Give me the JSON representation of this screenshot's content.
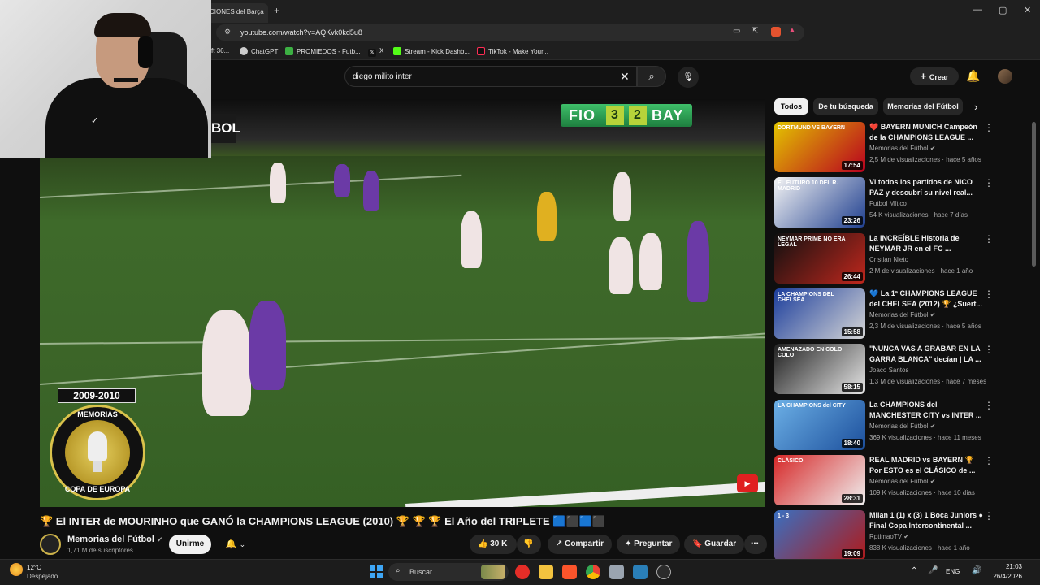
{
  "browser": {
    "tab_title": "CIONES del Barça",
    "new_tab": "+",
    "url": "youtube.com/watch?v=AQKvk0kd5u8",
    "bookmarks": [
      {
        "label": "ft 36...",
        "color": "#888888"
      },
      {
        "label": "ChatGPT",
        "color": "#cccccc"
      },
      {
        "label": "PROMIEDOS - Futb...",
        "color": "#3cb043"
      },
      {
        "label": "X",
        "color": "#ffffff"
      },
      {
        "label": "Stream - Kick Dashb...",
        "color": "#53fc18"
      },
      {
        "label": "TikTok - Make Your...",
        "color": "#ff2d55"
      }
    ],
    "window_controls": [
      "—",
      "▢",
      "✕"
    ]
  },
  "header": {
    "search_value": "diego milito inter",
    "create_label": "Crear"
  },
  "overlay": {
    "stream_label": "BOL"
  },
  "video": {
    "scoreboard": {
      "home": "FIO",
      "home_score": "3",
      "away_score": "2",
      "away": "BAY"
    },
    "season_label": "2009-2010",
    "badge_top": "MEMORIAS",
    "badge_bottom": "COPA DE EUROPA",
    "subscribe_icon": "▶"
  },
  "info": {
    "title": "🏆 El INTER de MOURINHO que GANÓ la CHAMPIONS LEAGUE (2010) 🏆 🏆 🏆 El Año del TRIPLETE 🟦⬛🟦⬛",
    "channel_name": "Memorias del Fútbol",
    "subscribers": "1,71 M de suscriptores",
    "join_label": "Unirme",
    "likes": "30 K",
    "share_label": "Compartir",
    "ask_label": "Preguntar",
    "save_label": "Guardar"
  },
  "sidebar": {
    "chips": [
      "Todos",
      "De tu búsqueda",
      "Memorias del Fútbol"
    ],
    "recommendations": [
      {
        "title": "❤️ BAYERN MUNICH Campeón de la CHAMPIONS LEAGUE ...",
        "channel": "Memorias del Fútbol",
        "verified": true,
        "views": "2,5 M de visualizaciones",
        "age": "hace 5 años",
        "duration": "17:54",
        "thumb_text": "DORTMUND VS BAYERN",
        "c1": "#e3c500",
        "c2": "#b8001f"
      },
      {
        "title": "Vi todos los partidos de NICO PAZ y descubrí su nivel real...",
        "channel": "Futbol Mítico",
        "verified": false,
        "views": "54 K visualizaciones",
        "age": "hace 7 días",
        "duration": "23:26",
        "thumb_text": "EL FUTURO 10 DEL R. MADRID",
        "c1": "#f4f4f4",
        "c2": "#1f3f8f"
      },
      {
        "title": "La INCREÍBLE Historia de NEYMAR JR en el FC ...",
        "channel": "Cristian Nieto",
        "verified": false,
        "views": "2 M de visualizaciones",
        "age": "hace 1 año",
        "duration": "26:44",
        "thumb_text": "NEYMAR PRIME NO ERA LEGAL",
        "c1": "#101010",
        "c2": "#c0271d"
      },
      {
        "title": "💙 La 1ª CHAMPIONS LEAGUE del CHELSEA (2012) 🏆 ¿Suert...",
        "channel": "Memorias del Fútbol",
        "verified": true,
        "views": "2,3 M de visualizaciones",
        "age": "hace 5 años",
        "duration": "15:58",
        "thumb_text": "LA CHAMPIONS DEL CHELSEA",
        "c1": "#1b3d9c",
        "c2": "#d6d6d6"
      },
      {
        "title": "\"NUNCA VAS A GRABAR EN LA GARRA BLANCA\" decían | LA ...",
        "channel": "Joaco Santos",
        "verified": false,
        "views": "1,3 M de visualizaciones",
        "age": "hace 7 meses",
        "duration": "58:15",
        "thumb_text": "AMENAZADO EN COLO COLO",
        "c1": "#202020",
        "c2": "#e6e6e6"
      },
      {
        "title": "La CHAMPIONS del MANCHESTER CITY vs INTER ...",
        "channel": "Memorias del Fútbol",
        "verified": true,
        "views": "369 K visualizaciones",
        "age": "hace 11 meses",
        "duration": "18:40",
        "thumb_text": "LA CHAMPIONS del CITY",
        "c1": "#6cb0e6",
        "c2": "#1c4f9c"
      },
      {
        "title": "REAL MADRID vs BAYERN 🏆 Por ESTO es el CLÁSICO de ...",
        "channel": "Memorias del Fútbol",
        "verified": true,
        "views": "109 K visualizaciones",
        "age": "hace 10 días",
        "duration": "28:31",
        "thumb_text": "CLÁSICO",
        "c1": "#d62828",
        "c2": "#f0f0f0"
      },
      {
        "title": "Milan 1 (1) x (3) 1 Boca Juniors ● Final Copa Intercontinental ...",
        "channel": "RptimaoTV",
        "verified": true,
        "views": "838 K visualizaciones",
        "age": "hace 1 año",
        "duration": "19:09",
        "thumb_text": "1 - 3",
        "c1": "#3a6fc0",
        "c2": "#b01a1a"
      }
    ]
  },
  "taskbar": {
    "temp": "12°C",
    "condition": "Despejado",
    "search_placeholder": "Buscar",
    "lang": "ENG",
    "time": "21:03",
    "date": "26/4/2026"
  }
}
